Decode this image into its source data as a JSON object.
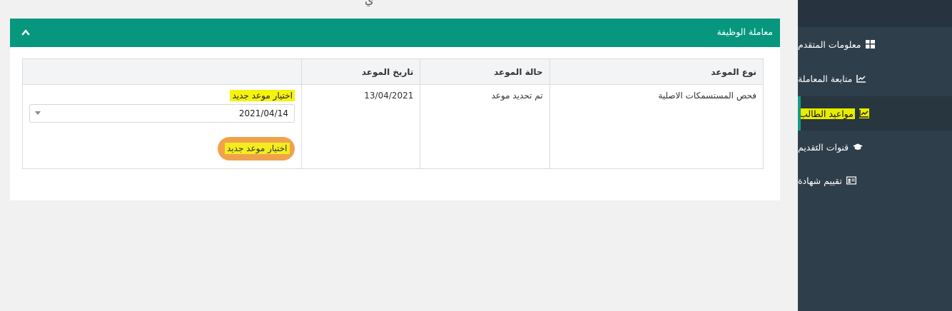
{
  "header": {
    "title_fragment": "ي"
  },
  "panel": {
    "title": "معاملة الوظيفة"
  },
  "table": {
    "headers": [
      "نوع الموعد",
      "حالة الموعد",
      "تاريخ الموعد",
      ""
    ],
    "rows": [
      {
        "type": "فحص المستسمكات الاصلية",
        "status": "تم تحديد موعد",
        "date": "13/04/2021",
        "choose_label": "اختيار موعد جديد",
        "select_value": "2021/04/14",
        "button_label": "اختيار موعد جديد"
      }
    ]
  },
  "sidebar": {
    "items": [
      {
        "label": "معلومات المتقدم",
        "icon": "dashboard-icon"
      },
      {
        "label": "متابعة المعاملة",
        "icon": "chart-line-icon"
      },
      {
        "label": "مواعيد الطالب",
        "icon": "chart-line-icon",
        "active": true
      },
      {
        "label": "قنوات التقديم",
        "icon": "graduation-cap-icon"
      },
      {
        "label": "تقييم شهادة",
        "icon": "id-card-icon"
      }
    ]
  },
  "colors": {
    "accent": "#07977f",
    "sidebar_bg": "#2f3e4b",
    "button": "#f0a24a",
    "highlight": "#f5f20d"
  }
}
